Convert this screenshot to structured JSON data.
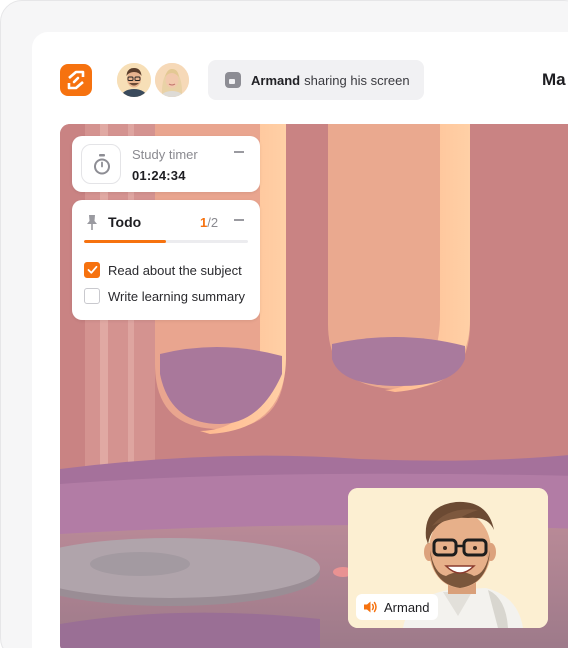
{
  "app": {
    "logo_icon": "app-logo-icon",
    "accent": "#f6720f"
  },
  "header": {
    "participants": [
      {
        "icon": "avatar-man"
      },
      {
        "icon": "avatar-woman"
      }
    ],
    "share_status": {
      "icon": "screen-share-icon",
      "name": "Armand",
      "text": "sharing his screen"
    },
    "truncated_title": "Ma"
  },
  "study_timer": {
    "title": "Study timer",
    "value": "01:24:34",
    "icon": "stopwatch-icon"
  },
  "todo": {
    "title": "Todo",
    "completed": "1",
    "separator_total": "/2",
    "progress_fraction": 0.5,
    "items": [
      {
        "label": "Read about the subject",
        "checked": true
      },
      {
        "label": "Write learning summary",
        "checked": false
      }
    ]
  },
  "video": {
    "speaker_name": "Armand",
    "speaker_icon": "speaker-volume-icon"
  }
}
